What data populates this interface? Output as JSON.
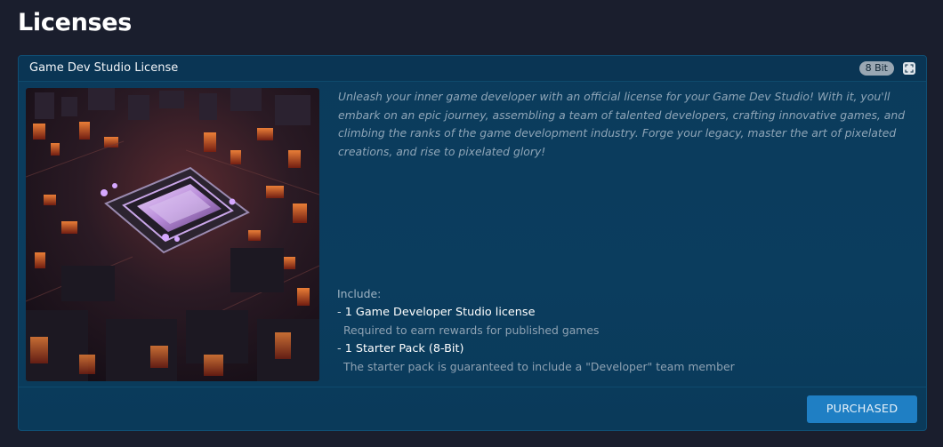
{
  "page": {
    "title": "Licenses"
  },
  "card": {
    "title": "Game Dev Studio License",
    "tier_badge": "8 Bit",
    "expand_icon": "expand-icon",
    "image_icon": "circuit-board-chip-image",
    "description": "Unleash your inner game developer with an official license for your Game Dev Studio! With it, you'll embark on an epic journey, assembling a team of talented developers, crafting innovative games, and climbing the ranks of the game development industry. Forge your legacy, master the art of pixelated creations, and rise to pixelated glory!",
    "include_label": "Include:",
    "items": [
      {
        "dash": "- ",
        "title": "1 Game Developer Studio license",
        "description": "Required to earn rewards for published games"
      },
      {
        "dash": "- ",
        "title": "1 Starter Pack (8-Bit)",
        "description": "The starter pack is guaranteed to include a \"Developer\" team member"
      }
    ],
    "button_label": "PURCHASED"
  },
  "colors": {
    "background": "#1a1e2d",
    "card": "#0b3b5c",
    "button": "#1f7fc4",
    "badge": "#9aa7b3"
  }
}
